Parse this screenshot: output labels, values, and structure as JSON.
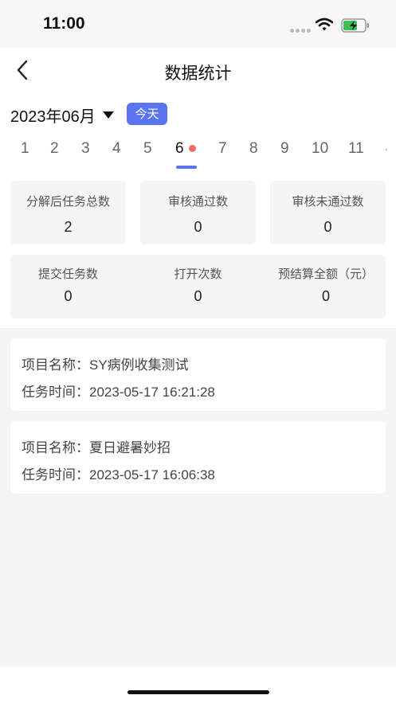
{
  "status_bar": {
    "time": "11:00"
  },
  "nav": {
    "title": "数据统计"
  },
  "calendar": {
    "month": "2023年06月",
    "today_label": "今天",
    "days": [
      "1",
      "2",
      "3",
      "4",
      "5",
      "6",
      "7",
      "8",
      "9",
      "10",
      "11"
    ],
    "selected_day": "6"
  },
  "stats": [
    {
      "label": "分解后任务总数",
      "value": "2"
    },
    {
      "label": "审核通过数",
      "value": "0"
    },
    {
      "label": "审核未通过数",
      "value": "0"
    },
    {
      "label": "提交任务数",
      "value": "0"
    },
    {
      "label": "打开次数",
      "value": "0"
    },
    {
      "label": "预结算全额（元）",
      "value": "0"
    }
  ],
  "tasks": [
    {
      "name_label": "项目名称：",
      "name": "SY病例收集测试",
      "time_label": "任务时间：",
      "time": "2023-05-17 16:21:28"
    },
    {
      "name_label": "项目名称：",
      "name": "夏日避暑妙招",
      "time_label": "任务时间：",
      "time": "2023-05-17 16:06:38"
    }
  ],
  "colors": {
    "accent": "#5b74f0",
    "dot": "#ef6b6b",
    "background": "#f5f5f5"
  }
}
